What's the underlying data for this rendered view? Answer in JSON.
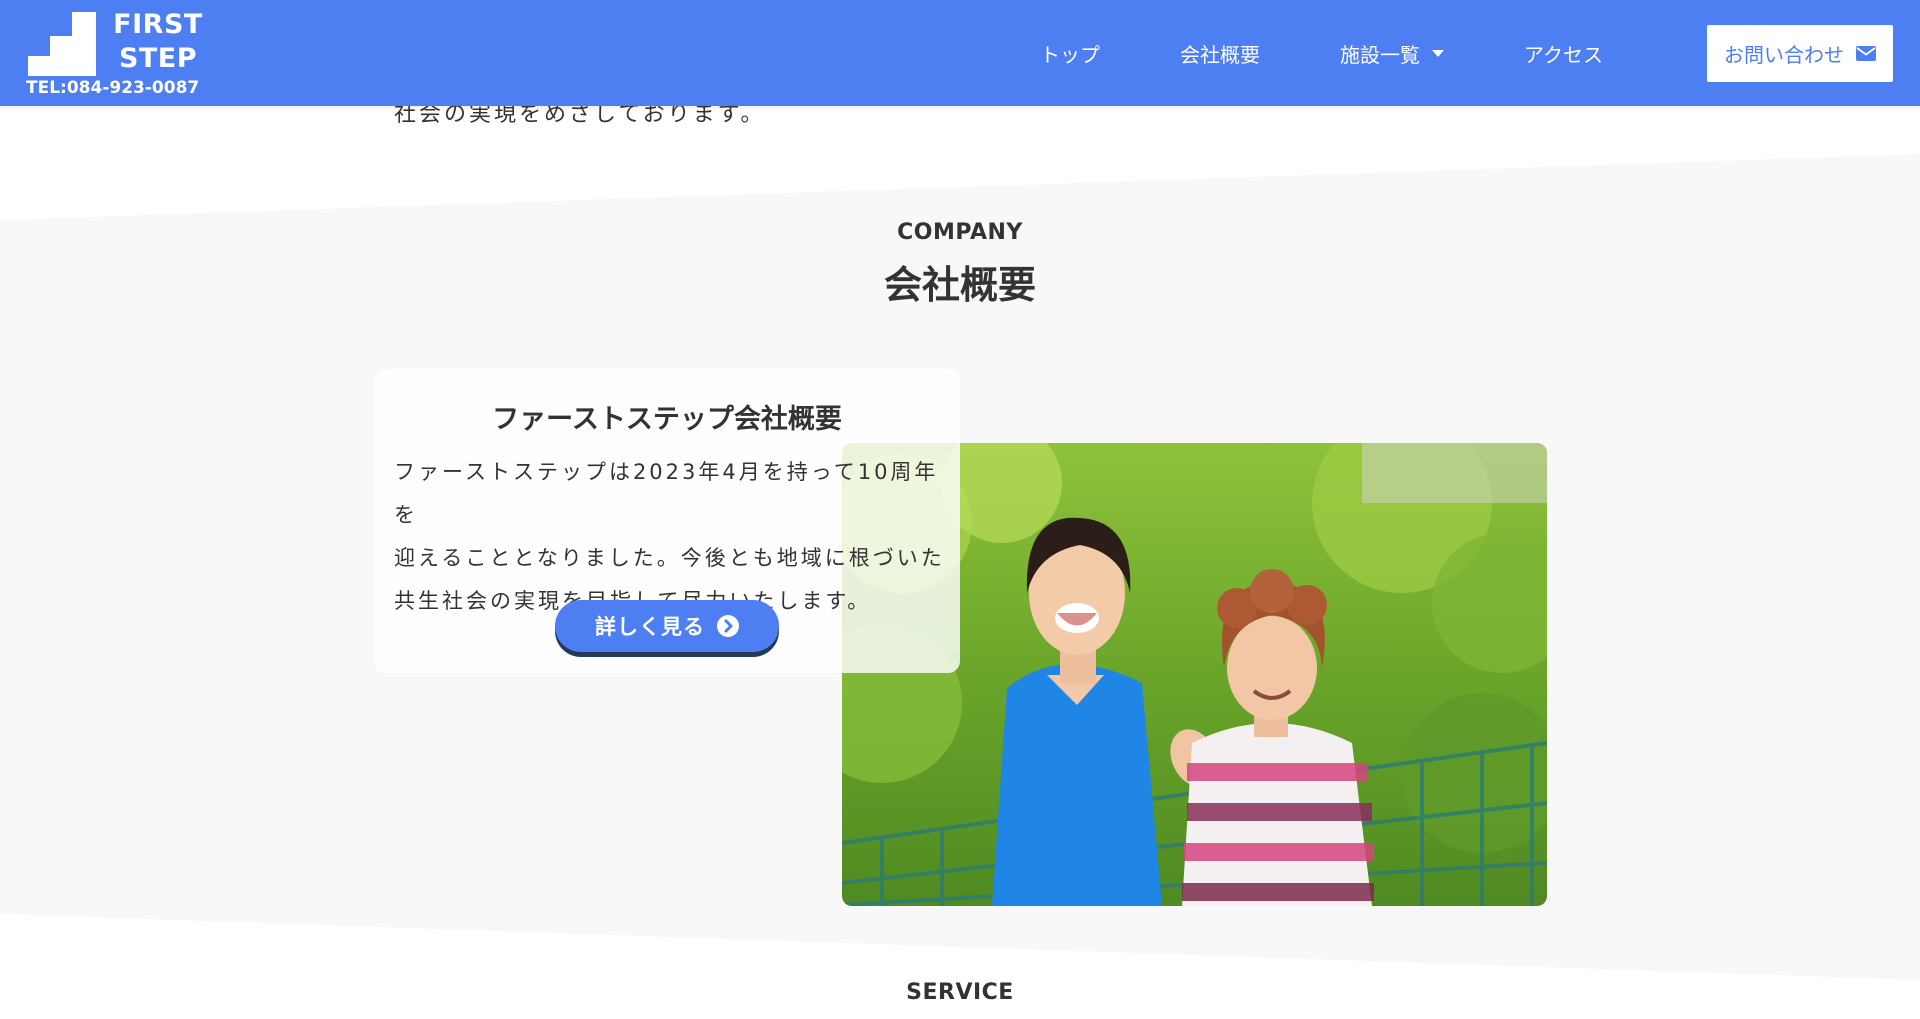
{
  "header": {
    "logo_line1": "FIRST",
    "logo_line2": "STEP",
    "tel": "TEL:084-923-0087",
    "nav": {
      "top": "トップ",
      "company": "会社概要",
      "facilities": "施設一覧",
      "access": "アクセス"
    },
    "contact_label": "お問い合わせ"
  },
  "intro": {
    "tail_text": "社会の実現をめざしております。"
  },
  "company_section": {
    "label_en": "COMPANY",
    "title": "会社概要",
    "card_title": "ファーストステップ会社概要",
    "card_lines": [
      "ファーストステップは2023年4月を持って10周年を",
      "迎えることとなりました。今後とも地域に根づいた",
      "共生社会の実現を目指して尽力いたします。"
    ],
    "more_label": "詳しく見る"
  },
  "service_section": {
    "label_en": "SERVICE"
  },
  "colors": {
    "brand_blue": "#4d7ef2",
    "section_gray": "#f8f8f8",
    "button_shadow": "#243a57",
    "text": "#333333"
  },
  "icons": {
    "dropdown": "caret-down-icon",
    "contact": "envelope-icon",
    "more": "chevron-circle-right-icon"
  }
}
